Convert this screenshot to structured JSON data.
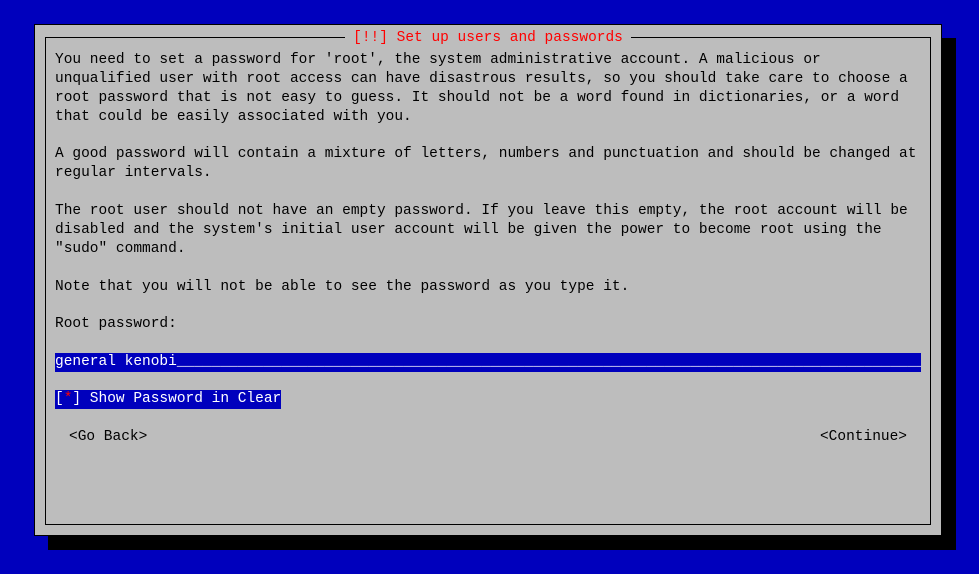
{
  "title": "[!!] Set up users and passwords",
  "paragraphs": {
    "p1": "You need to set a password for 'root', the system administrative account. A malicious or unqualified user with root access can have disastrous results, so you should take care to choose a root password that is not easy to guess. It should not be a word found in dictionaries, or a word that could be easily associated with you.",
    "p2": "A good password will contain a mixture of letters, numbers and punctuation and should be changed at regular intervals.",
    "p3": "The root user should not have an empty password. If you leave this empty, the root account will be disabled and the system's initial user account will be given the power to become root using the \"sudo\" command.",
    "p4": "Note that you will not be able to see the password as you type it."
  },
  "prompt": "Root password:",
  "password_value": "general kenobi",
  "password_padding": "__________________________________________________________________________________________",
  "checkbox": {
    "checked_char": "*",
    "label": " Show Password in Clear"
  },
  "buttons": {
    "back": "<Go Back>",
    "continue": "<Continue>"
  }
}
